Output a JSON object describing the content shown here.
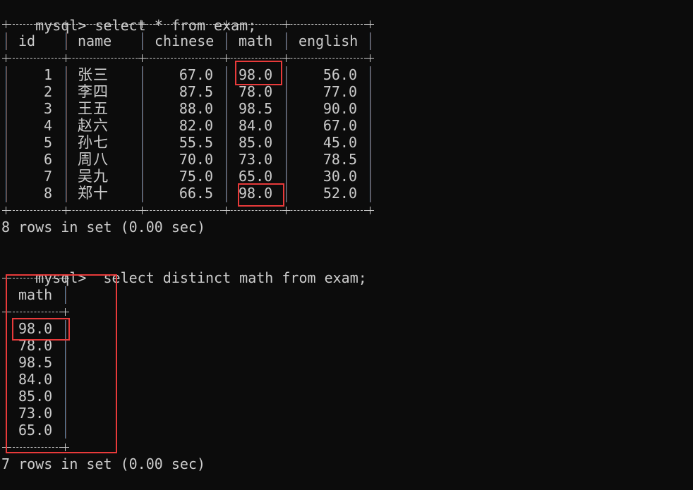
{
  "terminal": {
    "prompt": "mysql>",
    "background": "#0c0c0c",
    "text_color": "#cccccc",
    "highlight_color": "#e83a3a",
    "query1": {
      "command": " select * from exam;",
      "columns": [
        "id",
        "name",
        "chinese",
        "math",
        "english"
      ],
      "rows": [
        {
          "id": "1",
          "name": "张三",
          "chinese": "67.0",
          "math": "98.0",
          "english": "56.0"
        },
        {
          "id": "2",
          "name": "李四",
          "chinese": "87.5",
          "math": "78.0",
          "english": "77.0"
        },
        {
          "id": "3",
          "name": "王五",
          "chinese": "88.0",
          "math": "98.5",
          "english": "90.0"
        },
        {
          "id": "4",
          "name": "赵六",
          "chinese": "82.0",
          "math": "84.0",
          "english": "67.0"
        },
        {
          "id": "5",
          "name": "孙七",
          "chinese": "55.5",
          "math": "85.0",
          "english": "45.0"
        },
        {
          "id": "6",
          "name": "周八",
          "chinese": "70.0",
          "math": "73.0",
          "english": "78.5"
        },
        {
          "id": "7",
          "name": "吴九",
          "chinese": "75.0",
          "math": "65.0",
          "english": "30.0"
        },
        {
          "id": "8",
          "name": "郑十",
          "chinese": "66.5",
          "math": "98.0",
          "english": "52.0"
        }
      ],
      "result": "8 rows in set (0.00 sec)"
    },
    "query2": {
      "command": "  select distinct math from exam;",
      "columns": [
        "math"
      ],
      "rows": [
        "98.0",
        "78.0",
        "98.5",
        "84.0",
        "85.0",
        "73.0",
        "65.0"
      ],
      "result": "7 rows in set (0.00 sec)"
    },
    "annotations": [
      "highlight-math-row-1-98.0",
      "highlight-math-row-8-98.0",
      "highlight-distinct-result-table",
      "highlight-distinct-98.0"
    ]
  }
}
